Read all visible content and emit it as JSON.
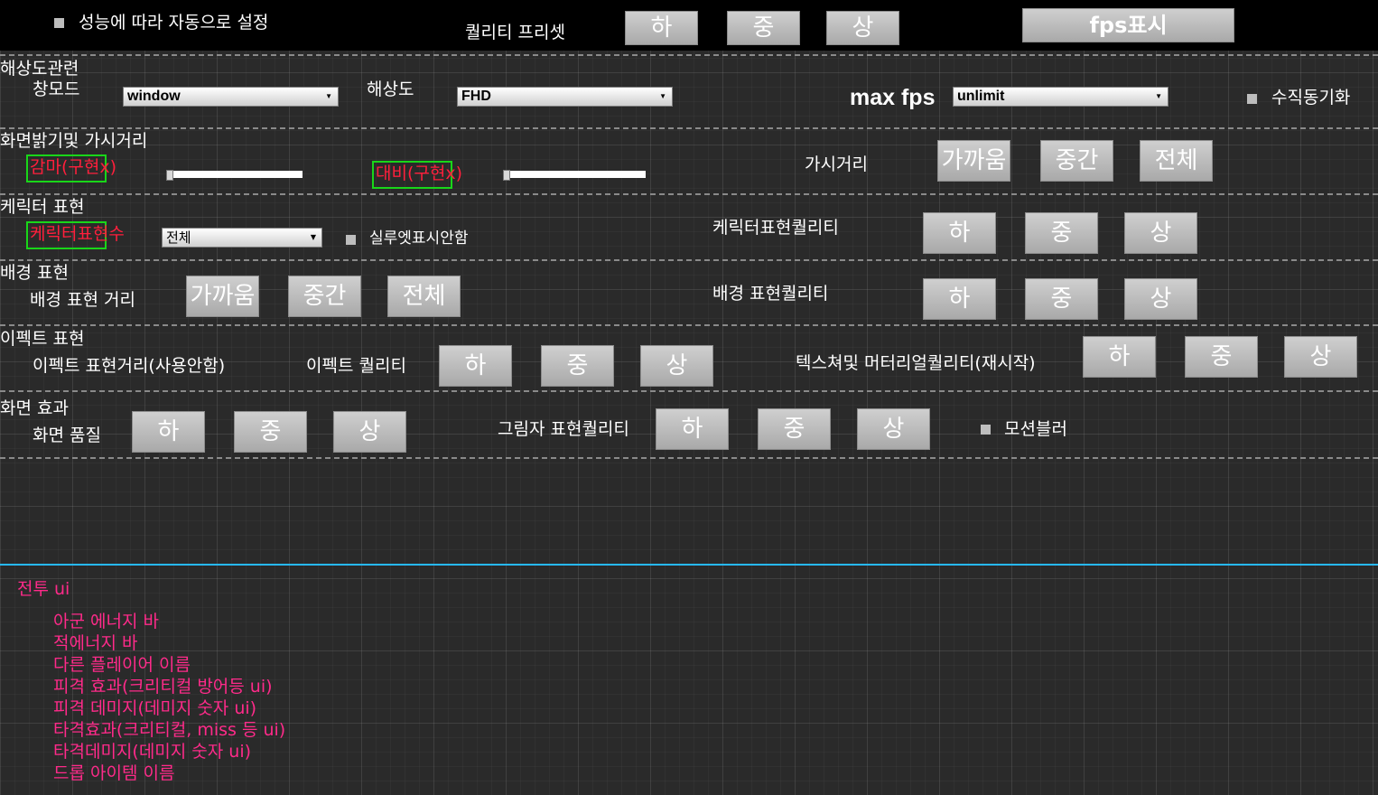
{
  "top": {
    "auto_perf_label": "성능에 따라 자동으로 설정",
    "quality_preset_label": "퀄리티 프리셋",
    "preset_low": "하",
    "preset_mid": "중",
    "preset_high": "상",
    "fps_display_button": "fps표시"
  },
  "resolution": {
    "section": "해상도관련",
    "window_mode_label": "창모드",
    "window_mode_value": "window",
    "resolution_label": "해상도",
    "resolution_value": "FHD",
    "max_fps_label": "max fps",
    "max_fps_value": "unlimit",
    "vsync_label": "수직동기화"
  },
  "brightness": {
    "section": "화면밝기및 가시거리",
    "gamma_label": "감마(구현x)",
    "contrast_label": "대비(구현x)",
    "view_distance_label": "가시거리",
    "near": "가까움",
    "mid": "중간",
    "all": "전체"
  },
  "character": {
    "section": "케릭터 표현",
    "count_label": "케릭터표현수",
    "count_value": "전체",
    "silhouette_label": "실루엣표시안함",
    "quality_label": "케릭터표현퀄리티",
    "low": "하",
    "mid": "중",
    "high": "상"
  },
  "background": {
    "section": "배경 표현",
    "distance_label": "배경 표현 거리",
    "near": "가까움",
    "mid": "중간",
    "all": "전체",
    "quality_label": "배경 표현퀄리티",
    "low": "하",
    "medium": "중",
    "high": "상"
  },
  "effect": {
    "section": "이펙트 표현",
    "distance_label": "이펙트 표현거리(사용안함)",
    "quality_label": "이펙트 퀄리티",
    "low": "하",
    "mid": "중",
    "high": "상",
    "texture_label": "텍스쳐및 머터리얼퀄리티(재시작)",
    "tex_low": "하",
    "tex_mid": "중",
    "tex_high": "상"
  },
  "screen": {
    "section": "화면 효과",
    "quality_label": "화면 품질",
    "low": "하",
    "mid": "중",
    "high": "상",
    "shadow_label": "그림자 표현퀄리티",
    "sh_low": "하",
    "sh_mid": "중",
    "sh_high": "상",
    "motion_blur_label": "모션블러"
  },
  "combat_ui": {
    "section": "전투 ui",
    "items": [
      "아군 에너지 바",
      "적에너지 바",
      "다른 플레이어 이름",
      "피격 효과(크리티컬 방어등 ui)",
      "피격 데미지(데미지 숫자 ui)",
      "타격효과(크리티컬, miss 등 ui)",
      "타격데미지(데미지 숫자 ui)",
      "드롭 아이템 이름"
    ]
  },
  "colors": {
    "accent_red": "#ff1f3c",
    "accent_pink": "#ff2a8a",
    "highlight_green": "#19d619",
    "divider_cyan": "#26b9ff"
  }
}
